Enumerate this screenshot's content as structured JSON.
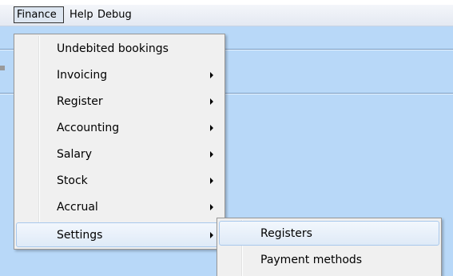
{
  "menubar": {
    "items": [
      {
        "label": "Finance"
      },
      {
        "label": "Help"
      },
      {
        "label": "Debug"
      }
    ]
  },
  "finance_menu": {
    "items": [
      {
        "label": "Undebited bookings",
        "has_submenu": false
      },
      {
        "label": "Invoicing",
        "has_submenu": true
      },
      {
        "label": "Register",
        "has_submenu": true
      },
      {
        "label": "Accounting",
        "has_submenu": true
      },
      {
        "label": "Salary",
        "has_submenu": true
      },
      {
        "label": "Stock",
        "has_submenu": true
      },
      {
        "label": "Accrual",
        "has_submenu": true
      },
      {
        "label": "Settings",
        "has_submenu": true
      }
    ]
  },
  "settings_submenu": {
    "items": [
      {
        "label": "Registers"
      },
      {
        "label": "Payment methods"
      }
    ]
  },
  "colors": {
    "workspace": "#b8d8f8",
    "menu_background": "#f0f0f0",
    "hover_border": "#a8c8ec"
  },
  "icons": {
    "submenu_arrow": "chevron-right-icon"
  }
}
